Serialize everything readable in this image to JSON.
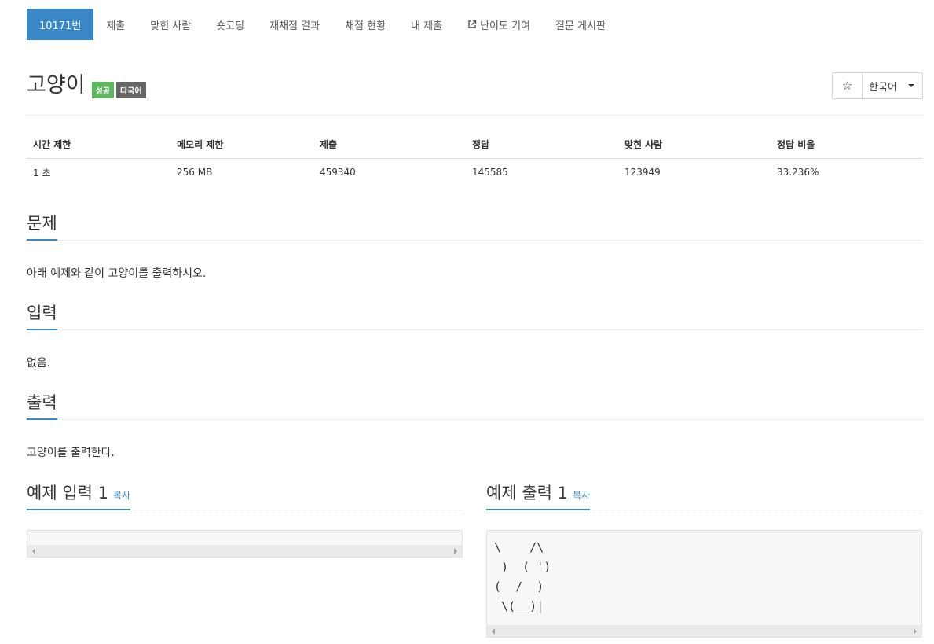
{
  "nav": {
    "items": [
      {
        "label": "10171번"
      },
      {
        "label": "제출"
      },
      {
        "label": "맞힌 사람"
      },
      {
        "label": "숏코딩"
      },
      {
        "label": "재채점 결과"
      },
      {
        "label": "채점 현황"
      },
      {
        "label": "내 제출"
      },
      {
        "label": "난이도 기여",
        "icon": "external-link-icon"
      },
      {
        "label": "질문 게시판"
      }
    ],
    "active_color": "#3a87c8"
  },
  "problem": {
    "title": "고양이",
    "badges": {
      "success": "성공",
      "multilang": "다국어"
    },
    "badge_colors": {
      "success": "#5cb85c",
      "multilang": "#666666"
    }
  },
  "toolbar": {
    "star_icon": "star-outline-icon",
    "language": "한국어"
  },
  "info_table": {
    "headers": [
      "시간 제한",
      "메모리 제한",
      "제출",
      "정답",
      "맞힌 사람",
      "정답 비율"
    ],
    "values": [
      "1 초",
      "256 MB",
      "459340",
      "145585",
      "123949",
      "33.236%"
    ]
  },
  "sections": {
    "description": {
      "title": "문제",
      "text": "아래 예제와 같이 고양이를 출력하시오."
    },
    "input": {
      "title": "입력",
      "text": "없음."
    },
    "output": {
      "title": "출력",
      "text": "고양이를 출력한다."
    }
  },
  "samples": {
    "input": {
      "title": "예제 입력 1",
      "copy_label": "복사",
      "content": ""
    },
    "output": {
      "title": "예제 출력 1",
      "copy_label": "복사",
      "content": "\\    /\\\n )  ( ')\n(  /  )\n \\(__)|"
    }
  }
}
